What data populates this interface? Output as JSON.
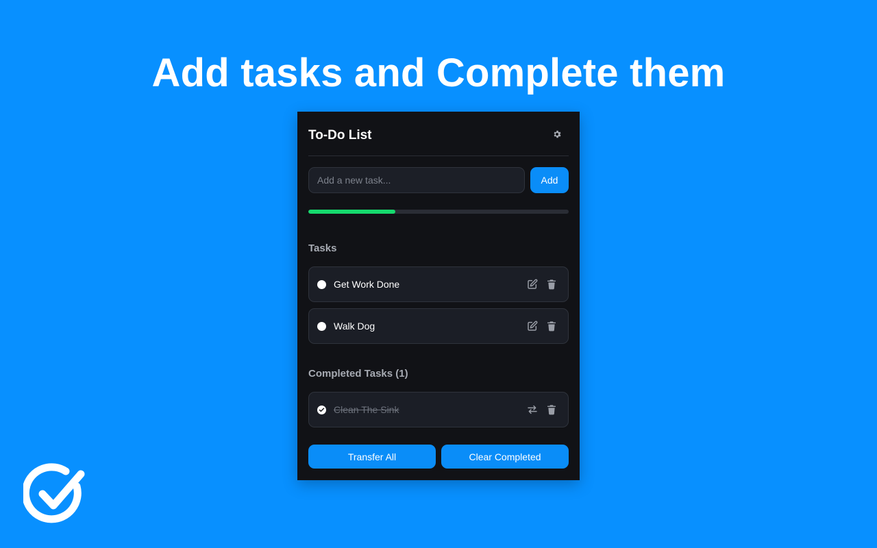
{
  "hero": {
    "title": "Add tasks and Complete them"
  },
  "app": {
    "title": "To-Do List",
    "settings_icon": "gear-icon",
    "input": {
      "placeholder": "Add a new task...",
      "value": ""
    },
    "add_label": "Add",
    "progress": {
      "completed": 1,
      "total": 3,
      "fraction": 0.333,
      "color": "#16d96d"
    },
    "tasks_heading": "Tasks",
    "tasks": [
      {
        "label": "Get Work Done"
      },
      {
        "label": "Walk Dog"
      }
    ],
    "completed_heading": "Completed Tasks (1)",
    "completed": [
      {
        "label": "Clean The Sink"
      }
    ],
    "transfer_all_label": "Transfer All",
    "clear_completed_label": "Clear Completed"
  },
  "colors": {
    "background": "#0890ff",
    "panel": "#111216",
    "accent": "#0a8df8",
    "progress": "#16d96d"
  }
}
